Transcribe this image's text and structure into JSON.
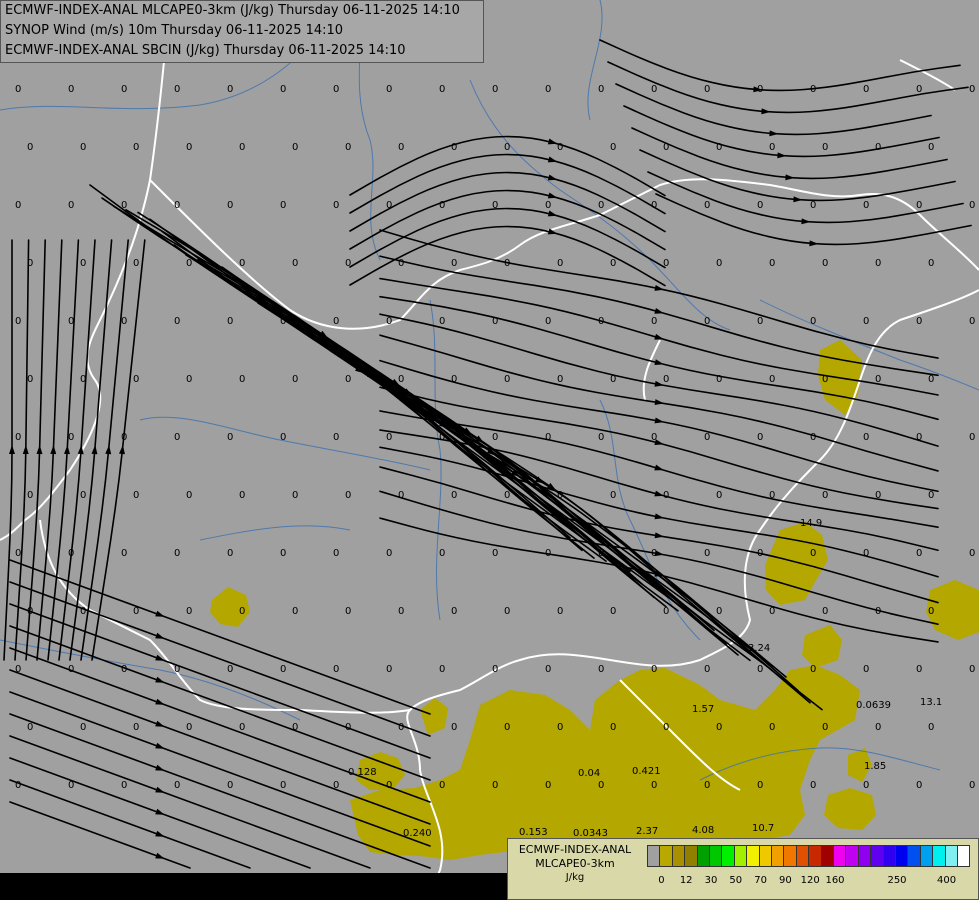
{
  "header": {
    "line1": "ECMWF-INDEX-ANAL MLCAPE0-3km (J/kg) Thursday 06-11-2025 14:10",
    "line2": "SYNOP Wind (m/s) 10m Thursday 06-11-2025 14:10",
    "line3": "ECMWF-INDEX-ANAL SBCIN (J/kg) Thursday 06-11-2025 14:10"
  },
  "legend": {
    "title_line1": "ECMWF-INDEX-ANAL",
    "title_line2": "MLCAPE0-3km",
    "unit": "J/kg",
    "colors": [
      "#a0a0a0",
      "#b8a800",
      "#a89000",
      "#908000",
      "#00a000",
      "#00c800",
      "#00f000",
      "#a0f000",
      "#f0f000",
      "#f0c800",
      "#f0a000",
      "#f07800",
      "#e05000",
      "#c82800",
      "#a00000",
      "#f000f0",
      "#c000f0",
      "#9000f0",
      "#6000f0",
      "#3000f0",
      "#0000f0",
      "#0050f0",
      "#00a0f0",
      "#00f0f0",
      "#80f0f0",
      "#ffffff"
    ],
    "ticks": [
      "0",
      "12",
      "30",
      "50",
      "70",
      "90",
      "120",
      "160",
      "250",
      "400"
    ]
  },
  "map": {
    "cin_labels": [
      "14.9",
      "3.24",
      "1.57",
      "0.0639",
      "13.1",
      "0.128",
      "0.04",
      "0.421",
      "1.85",
      "0.240",
      "0.153",
      "0.0343",
      "2.37",
      "4.08",
      "10.7"
    ],
    "zero_label": "0"
  }
}
